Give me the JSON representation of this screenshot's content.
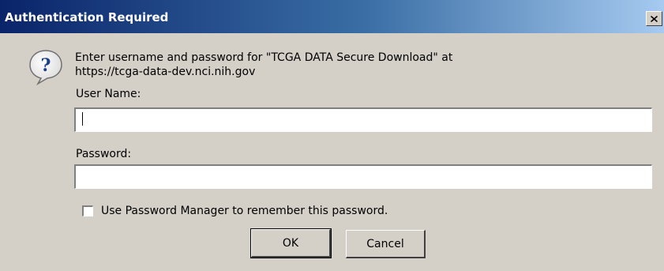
{
  "window": {
    "title": "Authentication Required",
    "close_glyph": "✕",
    "title_bar_color": "#0a246a",
    "face_color": "#d4d0c8"
  },
  "icon": {
    "name": "question-help-icon",
    "glyph": "?"
  },
  "message": {
    "line1": "Enter username and password for \"TCGA DATA Secure Download\" at",
    "line2": "https://tcga-data-dev.nci.nih.gov"
  },
  "form": {
    "username_label": "User Name:",
    "username_value": "",
    "password_label": "Password:",
    "password_value": "",
    "remember_label": "Use Password Manager to remember this password.",
    "remember_checked": false
  },
  "buttons": {
    "ok_label": "OK",
    "cancel_label": "Cancel"
  }
}
